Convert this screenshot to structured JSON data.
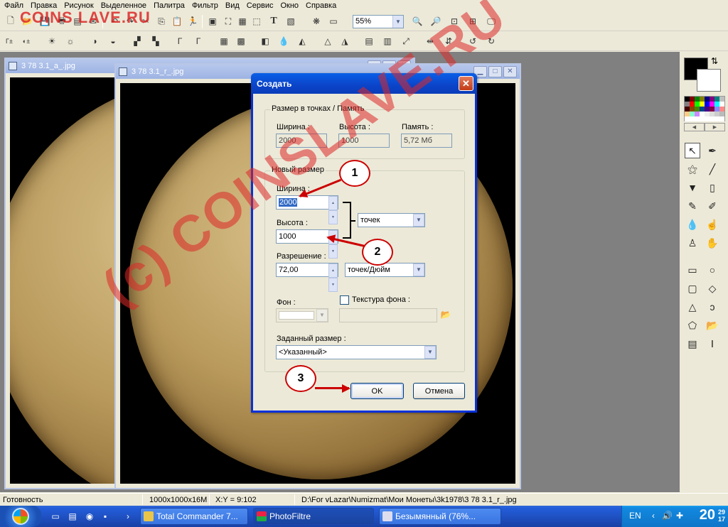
{
  "menu": [
    "Файл",
    "Правка",
    "Рисунок",
    "Выделенное",
    "Палитра",
    "Фильтр",
    "Вид",
    "Сервис",
    "Окно",
    "Справка"
  ],
  "toolbar": {
    "zoom_value": "55%"
  },
  "windows": {
    "a": {
      "title": "3 78 3.1_a_.jpg"
    },
    "r": {
      "title": "3 78 3.1_r_.jpg"
    }
  },
  "dialog": {
    "title": "Создать",
    "size_group": {
      "label": "Размер в точках / Память",
      "width_label": "Ширина :",
      "width_value": "2000",
      "height_label": "Высота :",
      "height_value": "1000",
      "memory_label": "Память :",
      "memory_value": "5,72 Мб"
    },
    "new_size_group": {
      "label": "Новый размер",
      "width_label": "Ширина :",
      "width_value": "2000",
      "height_label": "Высота :",
      "height_value": "1000",
      "unit_value": "точек",
      "resolution_label": "Разрешение :",
      "resolution_value": "72,00",
      "resolution_unit": "точек/Дюйм",
      "background_label": "Фон :",
      "texture_label": "Текстура фона :",
      "preset_label": "Заданный размер :",
      "preset_value": "<Указанный>"
    },
    "ok_label": "OK",
    "cancel_label": "Отмена"
  },
  "annotations": [
    "1",
    "2",
    "3"
  ],
  "statusbar": {
    "status": "Готовность",
    "image_info": "1000x1000x16M",
    "coords": "X:Y = 9:102",
    "path": "D:\\For vLazar\\Numizmat\\Мои Монеты\\3k1978\\3 78 3.1_r_.jpg"
  },
  "taskbar": {
    "tasks": [
      "Total Commander 7...",
      "PhotoFiltre",
      "Безымянный (76%..."
    ],
    "lang": "EN",
    "clock_hour": "20",
    "clock_min_top": "29",
    "clock_min_bottom": "17"
  },
  "watermark": {
    "corner": "COINS LAVE.RU",
    "diagonal": "(c) COINSLAVE.RU"
  },
  "colors": {
    "accent": "#0a5fe7",
    "annotation": "#cc0000",
    "watermark": "#dc2828"
  }
}
